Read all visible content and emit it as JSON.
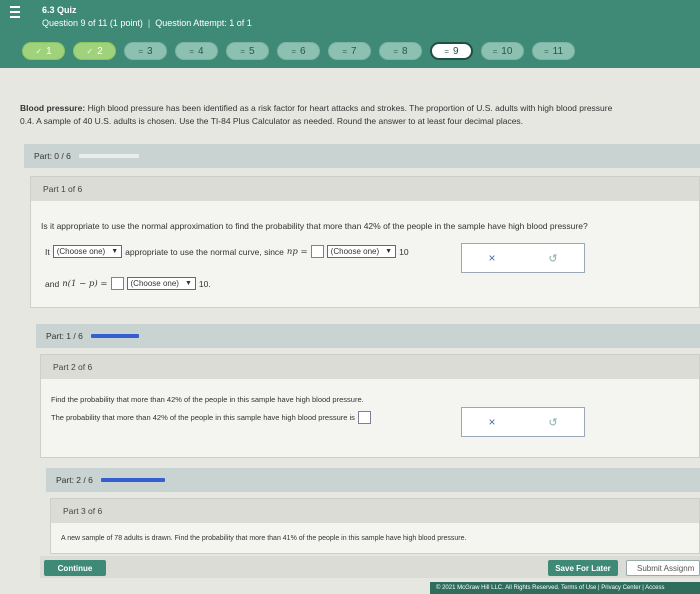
{
  "header": {
    "quiz_title": "6.3 Quiz",
    "question_label": "Question 9 of 11 (1 point)",
    "attempt_label": "Question Attempt: 1 of 1"
  },
  "questions": [
    {
      "label": "1",
      "state": "done",
      "mark": "✓"
    },
    {
      "label": "2",
      "state": "done",
      "mark": "✓"
    },
    {
      "label": "3",
      "state": "todo",
      "mark": "="
    },
    {
      "label": "4",
      "state": "todo",
      "mark": "="
    },
    {
      "label": "5",
      "state": "todo",
      "mark": "="
    },
    {
      "label": "6",
      "state": "todo",
      "mark": "="
    },
    {
      "label": "7",
      "state": "todo",
      "mark": "="
    },
    {
      "label": "8",
      "state": "todo",
      "mark": "="
    },
    {
      "label": "9",
      "state": "current",
      "mark": "="
    },
    {
      "label": "10",
      "state": "todo",
      "mark": "="
    },
    {
      "label": "11",
      "state": "todo",
      "mark": "="
    }
  ],
  "problem": {
    "title": "Blood pressure:",
    "line1": "High blood pressure has been identified as a risk factor for heart attacks and strokes. The proportion of U.S. adults with high blood pressure",
    "line2": "0.4. A sample of 40 U.S. adults is chosen. Use the TI-84 Plus Calculator as needed. Round the answer to at least four decimal places."
  },
  "overall_part": "Part: 0 / 6",
  "part1": {
    "header": "Part 1 of 6",
    "question": "Is it appropriate to use the normal approximation to find the probability that more than 42% of the people in the sample have high blood pressure?",
    "it": "It",
    "select1": "(Choose one)",
    "mid": "appropriate to use the normal curve, since",
    "np": "np =",
    "select2": "(Choose one)",
    "ten1": "10",
    "and": "and",
    "n1p": "n(1 − p) =",
    "select3": "(Choose one)",
    "ten2": "10."
  },
  "part_progress1": "Part: 1 / 6",
  "part2": {
    "header": "Part 2 of 6",
    "line1": "Find the probability that more than 42% of the people in this sample have high blood pressure.",
    "line2": "The probability that more than 42% of the people in this sample have high blood pressure is"
  },
  "part_progress2": "Part: 2 / 6",
  "part3": {
    "header": "Part 3 of 6",
    "line1": "A new sample of 78 adults is drawn. Find the probability that more than 41% of the people in this sample have high blood pressure."
  },
  "buttons": {
    "continue": "Continue",
    "save": "Save For Later",
    "submit": "Submit Assignm"
  },
  "footer": {
    "copyright": "© 2021 McGraw Hill LLC. All Rights Reserved.   Terms of Use  |  Privacy Center  |  Access"
  },
  "icons": {
    "clear": "×",
    "undo": "↺"
  },
  "colors": {
    "header": "#3f8a76",
    "done": "#9fd27a",
    "progress": "#355fd0"
  }
}
